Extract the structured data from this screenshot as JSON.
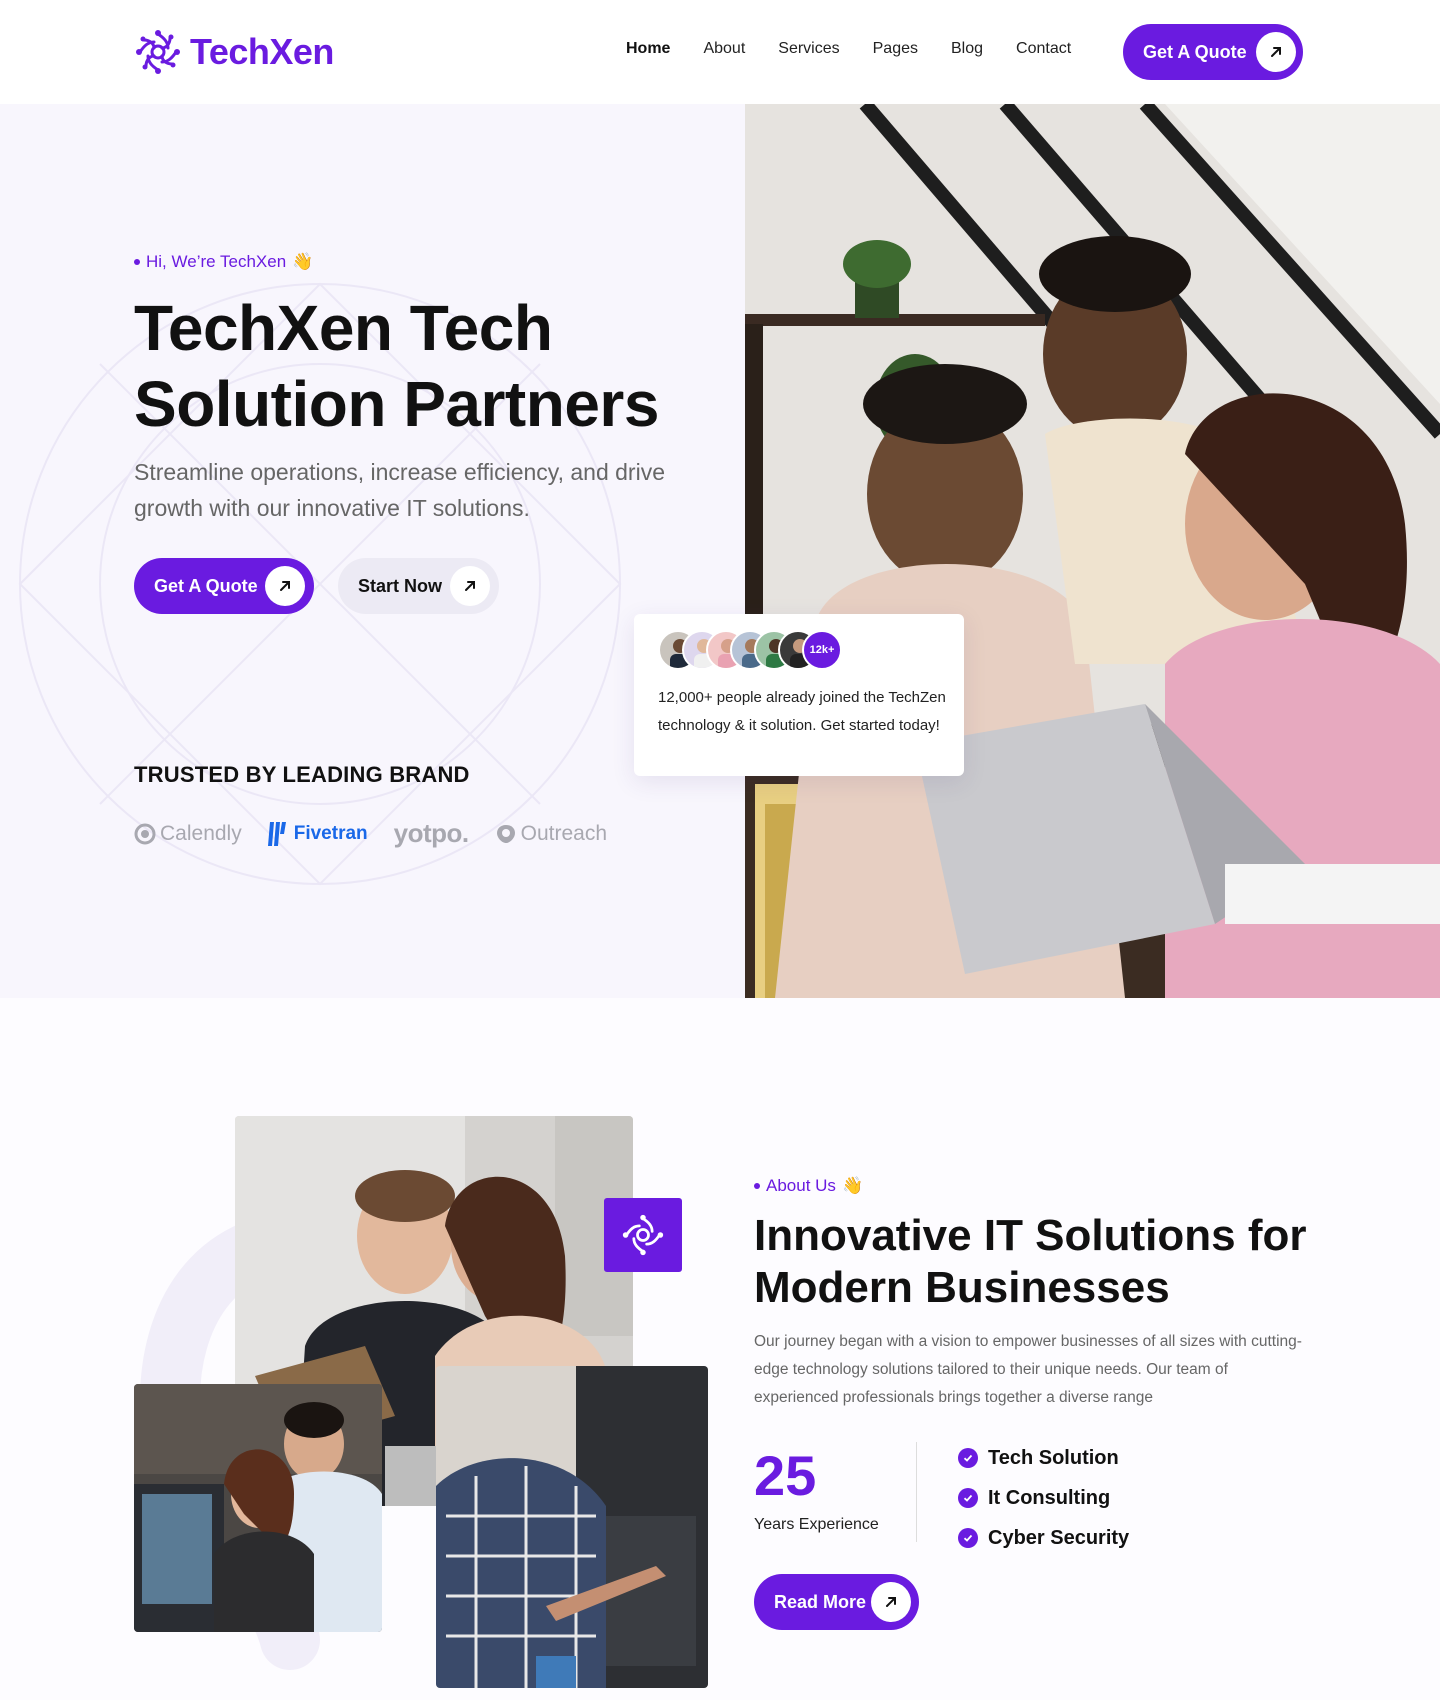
{
  "brand": {
    "name": "TechXen",
    "accent": "#6a1be0"
  },
  "nav": {
    "items": [
      {
        "label": "Home"
      },
      {
        "label": "About"
      },
      {
        "label": "Services"
      },
      {
        "label": "Pages"
      },
      {
        "label": "Blog"
      },
      {
        "label": "Contact"
      }
    ],
    "cta_label": "Get A Quote"
  },
  "hero": {
    "eyebrow": "Hi, We’re TechXen",
    "eyebrow_emoji": "👋",
    "title": "TechXen Tech Solution Partners",
    "subtitle": "Streamline operations, increase efficiency, and drive growth with our innovative IT solutions.",
    "primary_cta": "Get A Quote",
    "secondary_cta": "Start Now",
    "trusted_heading": "TRUSTED BY LEADING BRAND",
    "brands": [
      "Calendly",
      "Fivetran",
      "yotpo.",
      "Outreach"
    ],
    "join_card": {
      "count_badge": "12k+",
      "text": "12,000+ people already joined the TechZen technology & it solution. Get started today!"
    }
  },
  "about": {
    "eyebrow": "About Us",
    "eyebrow_emoji": "👋",
    "title": "Innovative IT Solutions for Modern Businesses",
    "text": "Our journey began with a vision to empower businesses of all sizes with cutting-edge technology solutions tailored to their unique needs. Our team of experienced professionals brings together a diverse range",
    "experience_number": "25",
    "experience_label": "Years Experience",
    "features": [
      "Tech Solution",
      "It Consulting",
      "Cyber Security"
    ],
    "cta": "Read More"
  }
}
